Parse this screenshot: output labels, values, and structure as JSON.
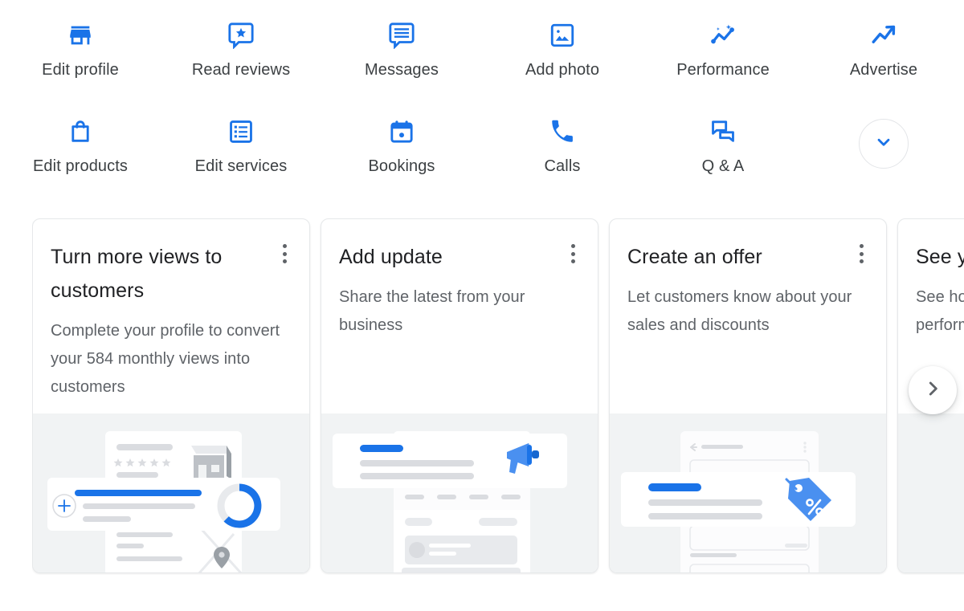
{
  "quick_actions": {
    "rows": [
      [
        {
          "label": "Edit profile",
          "icon": "storefront-icon"
        },
        {
          "label": "Read reviews",
          "icon": "review-star-bubble-icon"
        },
        {
          "label": "Messages",
          "icon": "message-lines-icon"
        },
        {
          "label": "Add photo",
          "icon": "image-icon"
        },
        {
          "label": "Performance",
          "icon": "insights-sparkline-icon"
        },
        {
          "label": "Advertise",
          "icon": "trending-up-arrow-icon"
        }
      ],
      [
        {
          "label": "Edit products",
          "icon": "shopping-bag-icon"
        },
        {
          "label": "Edit services",
          "icon": "list-box-icon"
        },
        {
          "label": "Bookings",
          "icon": "calendar-dot-icon"
        },
        {
          "label": "Calls",
          "icon": "phone-icon"
        },
        {
          "label": "Q & A",
          "icon": "question-answer-icon"
        }
      ]
    ],
    "expand_more": {
      "icon": "chevron-down-icon"
    }
  },
  "carousel": {
    "next": {
      "icon": "chevron-right-icon"
    },
    "cards": [
      {
        "title": "Turn more views to customers",
        "subtitle": "Complete your profile to convert your 584 monthly views into customers",
        "menu_icon": "more-vert-icon",
        "art": "profile-completion-illustration"
      },
      {
        "title": "Add update",
        "subtitle": "Share the latest from your business",
        "menu_icon": "more-vert-icon",
        "art": "megaphone-update-illustration"
      },
      {
        "title": "Create an offer",
        "subtitle": "Let customers know about your sales and discounts",
        "menu_icon": "more-vert-icon",
        "art": "discount-tag-illustration"
      },
      {
        "title": "See your performance",
        "subtitle": "See how your business is performing",
        "menu_icon": "more-vert-icon",
        "art": "performance-illustration"
      }
    ]
  },
  "colors": {
    "accent_blue": "#1a73e8",
    "text_primary": "#202124",
    "text_secondary": "#5f6368",
    "art_background": "#f1f3f4",
    "placeholder_gray": "#dadce0"
  }
}
